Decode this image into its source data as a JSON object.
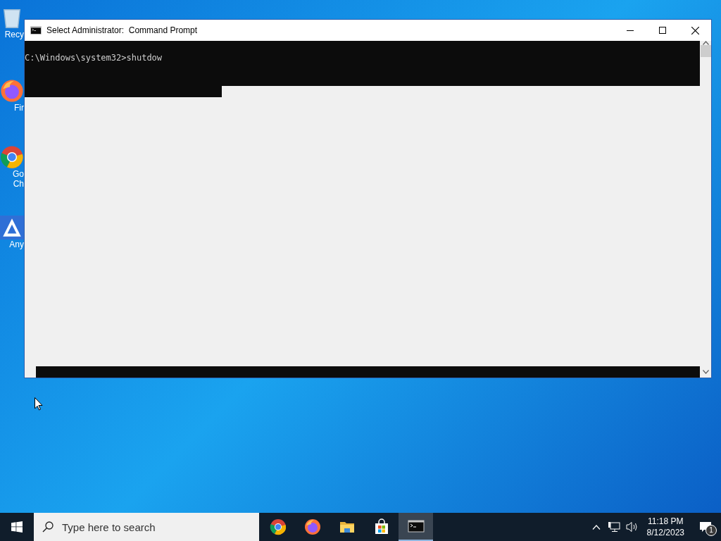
{
  "desktop_icons": [
    {
      "kind": "recycle",
      "label_lines": [
        "Recy"
      ]
    },
    {
      "kind": "firefox",
      "label_lines": [
        "Fir"
      ]
    },
    {
      "kind": "chrome",
      "label_lines": [
        "Go",
        "Ch"
      ]
    },
    {
      "kind": "anydesk",
      "label_lines": [
        "Any"
      ]
    }
  ],
  "window": {
    "title": "Select Administrator:  Command Prompt",
    "console_lines": [
      "C:\\Windows\\system32>shutdow"
    ]
  },
  "taskbar": {
    "search": {
      "placeholder": "Type here to search"
    },
    "apps": [
      {
        "kind": "chrome",
        "selected": false
      },
      {
        "kind": "firefox",
        "selected": false
      },
      {
        "kind": "explorer",
        "selected": false
      },
      {
        "kind": "store",
        "selected": false
      },
      {
        "kind": "terminal",
        "selected": true
      }
    ],
    "time": "11:18 PM",
    "date": "8/12/2023",
    "notification_count": "1"
  }
}
